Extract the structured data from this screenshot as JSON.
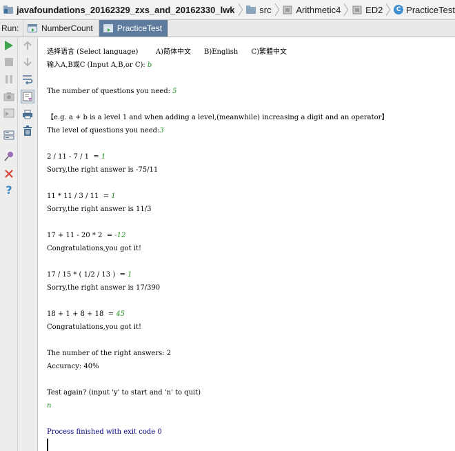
{
  "breadcrumb": {
    "project": "javafoundations_20162329_zxs_and_20162330_lwk",
    "items": [
      "src",
      "Arithmetic4",
      "ED2",
      "PracticeTest"
    ],
    "class_icon_letter": "C"
  },
  "run": {
    "label": "Run:",
    "tabs": [
      {
        "label": "NumberCount",
        "active": false
      },
      {
        "label": "PracticeTest",
        "active": true
      }
    ]
  },
  "toolbar": {
    "left": [
      "run-icon",
      "stop-icon",
      "pause-icon",
      "dump-threads-icon",
      "restore-layout-icon",
      "pin-tab-icon",
      "settings-icon",
      "close-icon",
      "help-icon"
    ],
    "right": [
      "up-arrow-icon",
      "down-arrow-icon",
      "soft-wrap-icon",
      "scroll-to-end-icon",
      "print-icon",
      "trash-icon"
    ]
  },
  "console": {
    "l1": "选择语言 (Select language)        A)简体中文      B)English      C)繁體中文",
    "l2_prompt": "输入A,B或C (Input A,B,or C): ",
    "l2_input": "b",
    "l3_prompt": "The number of questions you need: ",
    "l3_input": "5",
    "l4": "【e.g. a + b is a level 1 and when adding a level,(meanwhile) increasing a digit and an operator】",
    "l5_prompt": "The level of questions you need:",
    "l5_input": "3",
    "q1_expr": "2 / 11 - 7 / 1  = ",
    "q1_input": "1",
    "q1_result": "Sorry,the right answer is -75/11",
    "q2_expr": "11 * 11 / 3 / 11  = ",
    "q2_input": "1",
    "q2_result": "Sorry,the right answer is 11/3",
    "q3_expr": "17 + 11 - 20 * 2  = ",
    "q3_input": "-12",
    "q3_result": "Congratulations,you got it!",
    "q4_expr": "17 / 15 * ( 1/2 / 13 )  = ",
    "q4_input": "1",
    "q4_result": "Sorry,the right answer is 17/390",
    "q5_expr": "18 + 1 + 8 + 18  = ",
    "q5_input": "45",
    "q5_result": "Congratulations,you got it!",
    "right_answers": "The number of the right answers: 2",
    "accuracy": "Accuracy: 40%",
    "again_prompt": "Test again? (input 'y' to start and 'n' to quit)",
    "again_input": "n",
    "exit": "Process finished with exit code 0"
  },
  "colors": {
    "user_input": "#1e8a1e",
    "exit_message": "#000080",
    "active_tab": "#5e7c9d"
  }
}
